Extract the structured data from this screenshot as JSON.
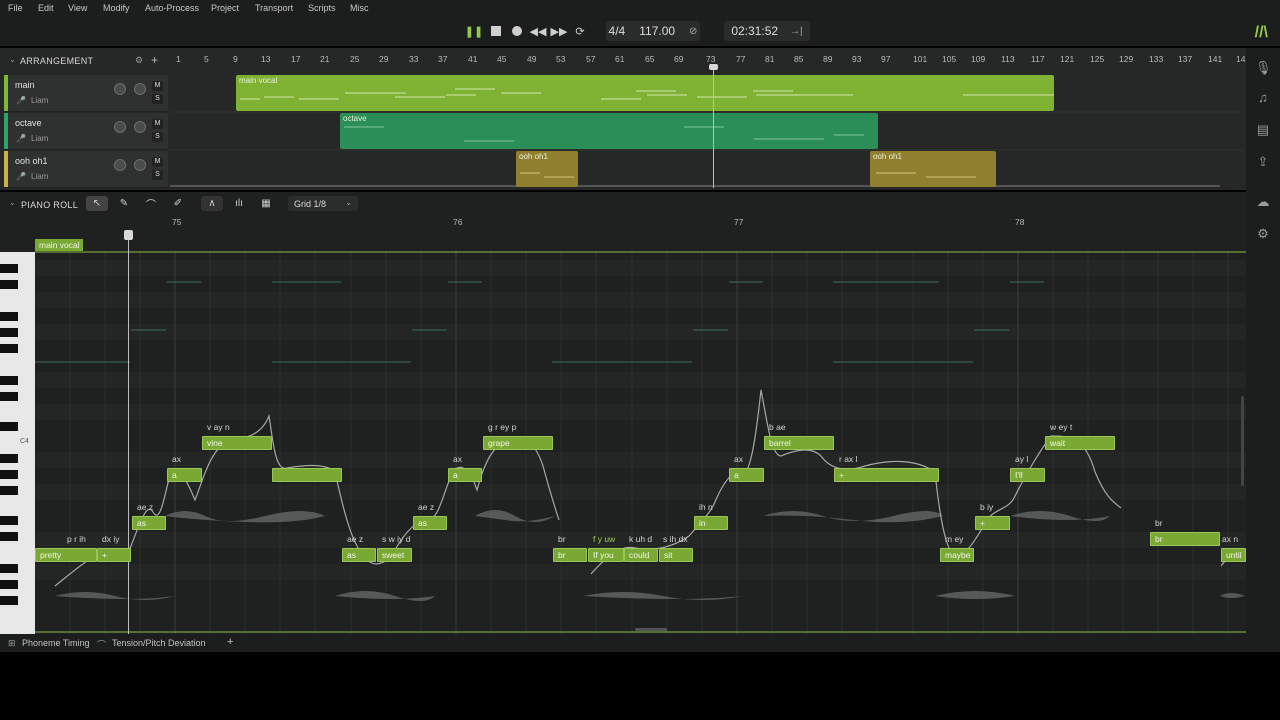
{
  "menu": [
    "File",
    "Edit",
    "View",
    "Modify",
    "Auto-Process",
    "Project",
    "Transport",
    "Scripts",
    "Misc"
  ],
  "transport": {
    "play_icon": "pause-icon",
    "time_signature": "4/4",
    "tempo": "117.00",
    "time": "02:31:52"
  },
  "arrangement": {
    "title": "ARRANGEMENT",
    "ruler": [
      "1",
      "5",
      "9",
      "13",
      "17",
      "21",
      "25",
      "29",
      "33",
      "37",
      "41",
      "45",
      "49",
      "53",
      "57",
      "61",
      "65",
      "69",
      "73",
      "77",
      "81",
      "85",
      "89",
      "93",
      "97",
      "101",
      "105",
      "109",
      "113",
      "117",
      "121",
      "125",
      "129",
      "133",
      "137",
      "141",
      "14"
    ],
    "tracks": [
      {
        "name": "main",
        "singer": "Liam",
        "color": "#7fb93a"
      },
      {
        "name": "octave",
        "singer": "Liam",
        "color": "#2fa36a"
      },
      {
        "name": "ooh oh1",
        "singer": "Liam",
        "color": "#c9b547"
      }
    ],
    "mute": "M",
    "solo": "S",
    "clips": [
      {
        "label": "main vocal",
        "color": "#7fb233"
      },
      {
        "label": "octave",
        "color": "#2b8d57"
      },
      {
        "label": "ooh oh1",
        "color": "#8f7f2e"
      },
      {
        "label": "ooh oh1",
        "color": "#8f7f2e"
      }
    ]
  },
  "piano_roll": {
    "title": "PIANO ROLL",
    "grid": "Grid 1/8",
    "clip_label": "main vocal",
    "ruler": [
      "75",
      "76",
      "77",
      "78"
    ],
    "key_label": "C4",
    "notes": [
      {
        "lyric": "pretty",
        "phon": "p r ih"
      },
      {
        "lyric": "+",
        "phon": "dx iy"
      },
      {
        "lyric": "as",
        "phon": "ae z"
      },
      {
        "lyric": "a",
        "phon": "ax"
      },
      {
        "lyric": "vine",
        "phon": "v ay n"
      },
      {
        "lyric": "",
        "phon": ""
      },
      {
        "lyric": "as",
        "phon": "ae z"
      },
      {
        "lyric": "sweet",
        "phon": "s w iy d"
      },
      {
        "lyric": "as",
        "phon": "ae z"
      },
      {
        "lyric": "a",
        "phon": "ax"
      },
      {
        "lyric": "grape",
        "phon": "g r ey p"
      },
      {
        "lyric": "br",
        "phon": "br"
      },
      {
        "lyric": "If you",
        "phon": "f y uw"
      },
      {
        "lyric": "could",
        "phon": "k uh d"
      },
      {
        "lyric": "sit",
        "phon": "s ih dx"
      },
      {
        "lyric": "in",
        "phon": "ih n"
      },
      {
        "lyric": "a",
        "phon": "ax"
      },
      {
        "lyric": "barrel",
        "phon": "b ae"
      },
      {
        "lyric": "+",
        "phon": "r ax l"
      },
      {
        "lyric": "maybe",
        "phon": "m ey"
      },
      {
        "lyric": "+",
        "phon": "b iy"
      },
      {
        "lyric": "I'll",
        "phon": "ay l"
      },
      {
        "lyric": "wait",
        "phon": "w ey t"
      },
      {
        "lyric": "br",
        "phon": "br"
      },
      {
        "lyric": "until",
        "phon": "ax n"
      }
    ]
  },
  "bottom": {
    "tab1": "Phoneme Timing",
    "tab2": "Tension/Pitch Deviation",
    "add": "+"
  }
}
